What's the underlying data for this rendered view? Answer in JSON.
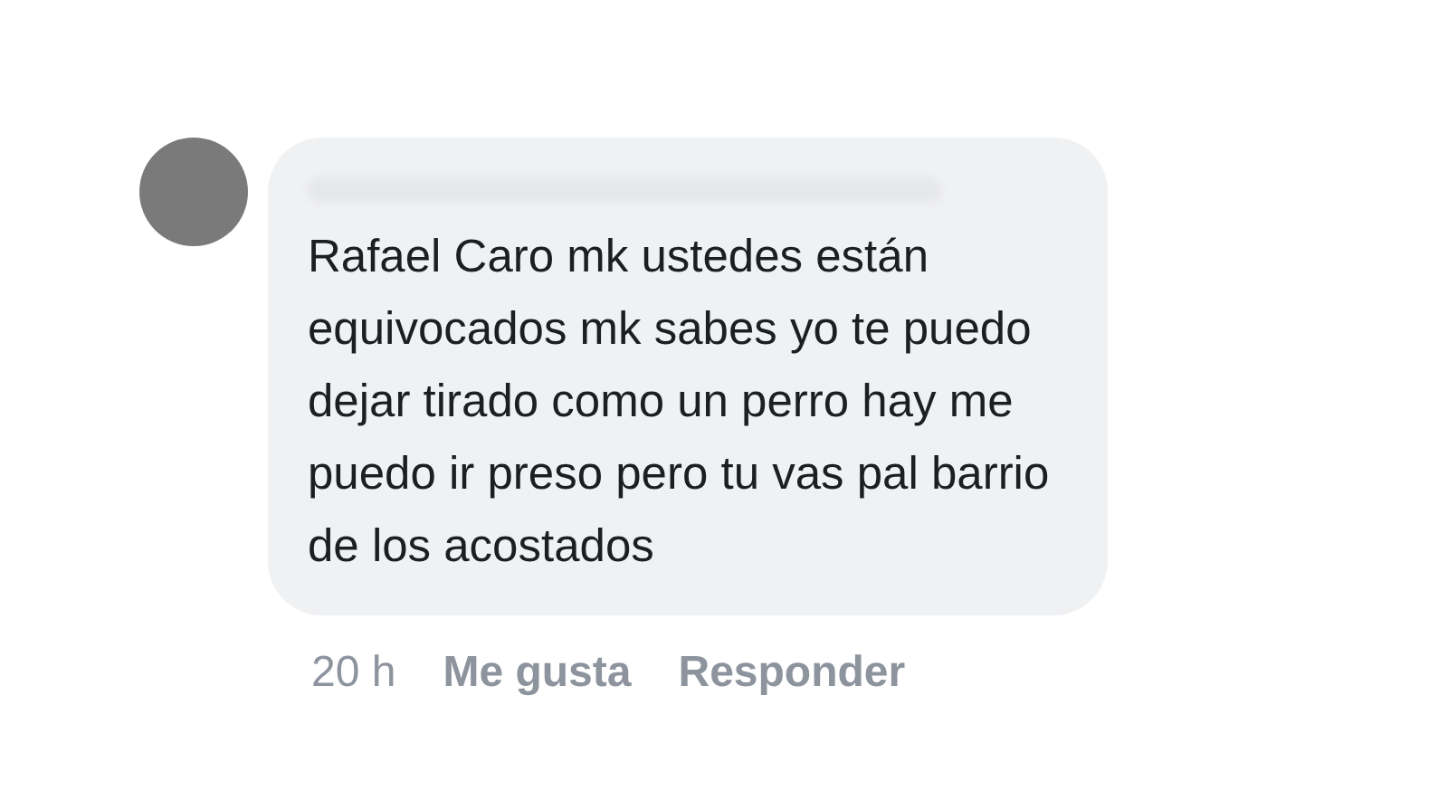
{
  "comment": {
    "text": "Rafael Caro mk ustedes están equivocados mk sabes yo te puedo dejar tirado como un perro hay me puedo ir preso pero tu vas pal barrio de los acostados"
  },
  "footer": {
    "time": "20 h",
    "actions": [
      "Me gusta",
      "Responder"
    ]
  }
}
